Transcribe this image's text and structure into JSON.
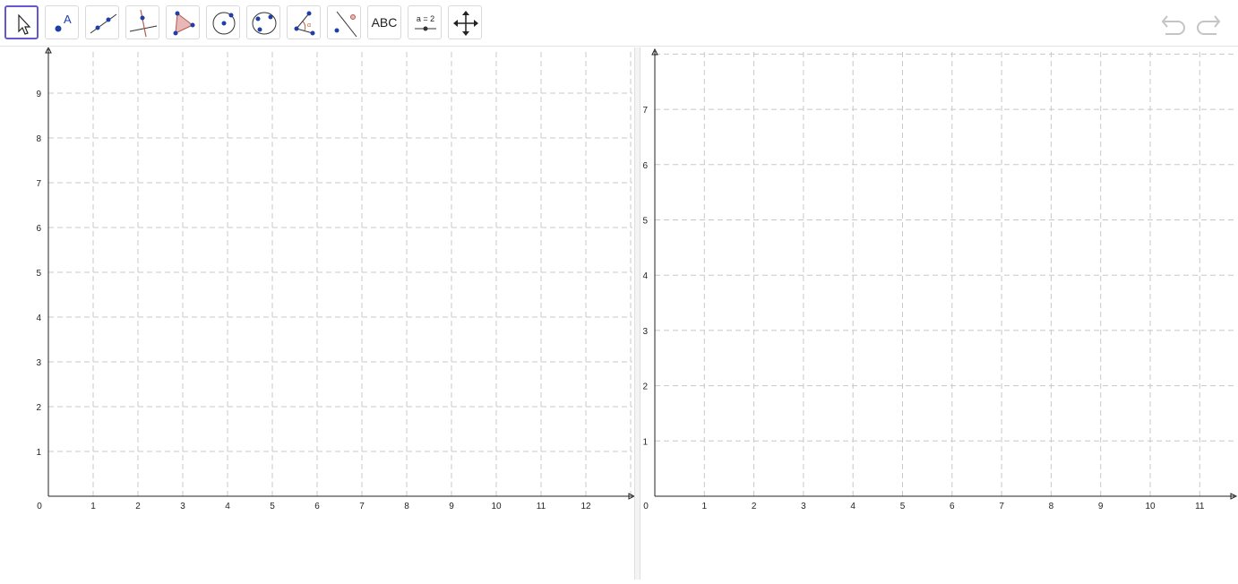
{
  "toolbar": {
    "tools": [
      {
        "name": "move-tool",
        "icon": "cursor-arrow-icon"
      },
      {
        "name": "point-tool",
        "icon": "point-icon",
        "label": "A"
      },
      {
        "name": "line-tool",
        "icon": "line-icon"
      },
      {
        "name": "perpendicular-line-tool",
        "icon": "perpendicular-line-icon"
      },
      {
        "name": "polygon-tool",
        "icon": "polygon-icon"
      },
      {
        "name": "circle-tool",
        "icon": "circle-icon"
      },
      {
        "name": "circle-through-three-points-tool",
        "icon": "circle-three-points-icon"
      },
      {
        "name": "angle-tool",
        "icon": "angle-icon",
        "label": "α"
      },
      {
        "name": "reflect-tool",
        "icon": "reflect-icon"
      },
      {
        "name": "text-tool",
        "icon": "text-icon",
        "label": "ABC"
      },
      {
        "name": "slider-tool",
        "icon": "slider-icon",
        "label": "a = 2"
      },
      {
        "name": "move-graphics-view-tool",
        "icon": "move-arrows-icon"
      }
    ],
    "selected_tool": "move-tool",
    "undo_icon": "undo-icon",
    "redo_icon": "redo-icon"
  },
  "graphics_left": {
    "x_ticks": [
      "0",
      "1",
      "2",
      "3",
      "4",
      "5",
      "6",
      "7",
      "8",
      "9",
      "10",
      "11",
      "12"
    ],
    "y_ticks": [
      "1",
      "2",
      "3",
      "4",
      "5",
      "6",
      "7",
      "8",
      "9"
    ],
    "grid": true,
    "grid_style": "dashed"
  },
  "graphics_right": {
    "x_ticks": [
      "0",
      "1",
      "2",
      "3",
      "4",
      "5",
      "6",
      "7",
      "8",
      "9",
      "10",
      "11"
    ],
    "y_ticks": [
      "1",
      "2",
      "3",
      "4",
      "5",
      "6",
      "7"
    ],
    "grid": true,
    "grid_style": "dashed"
  },
  "colors": {
    "selected_border": "#6557d2",
    "point_blue": "#1f3fa8",
    "grid": "#c8c8c8",
    "axis": "#222222",
    "polygon_fill": "#e6b8b8",
    "accent_red": "#b85a4a"
  }
}
